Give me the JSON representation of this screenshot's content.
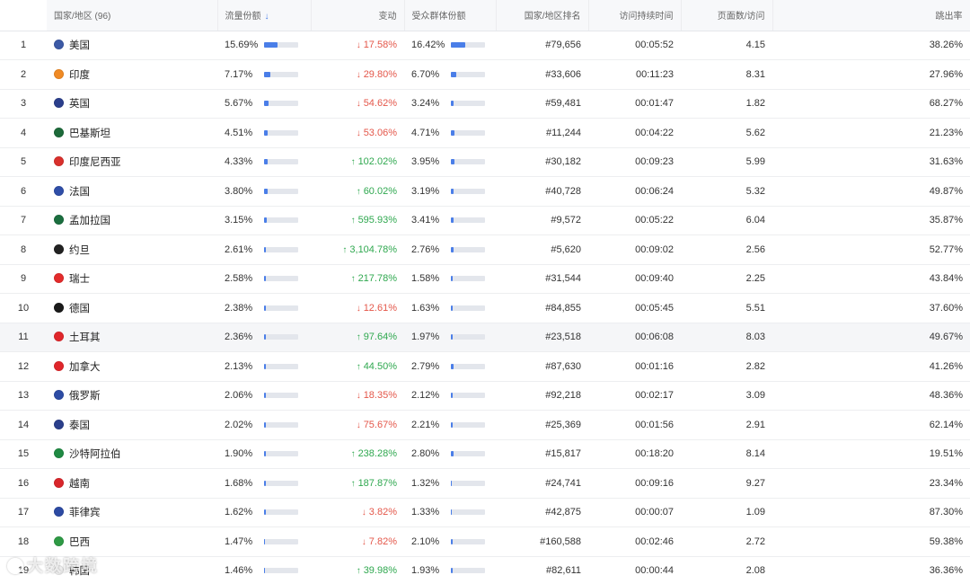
{
  "header": {
    "country": "国家/地区 (96)",
    "traffic_share": "流量份额",
    "change": "变动",
    "audience_share": "受众群体份额",
    "rank": "国家/地区排名",
    "duration": "访问持续时间",
    "pages": "页面数/访问",
    "bounce": "跳出率"
  },
  "rows": [
    {
      "n": "1",
      "name": "美国",
      "share": "15.69%",
      "share_v": 0.1569,
      "dir": "down",
      "chg": "17.58%",
      "aud": "16.42%",
      "aud_v": 0.1642,
      "rank": "#79,656",
      "dur": "00:05:52",
      "pages": "4.15",
      "bounce": "38.26%",
      "flag": "#3c5aa6"
    },
    {
      "n": "2",
      "name": "印度",
      "share": "7.17%",
      "share_v": 0.0717,
      "dir": "down",
      "chg": "29.80%",
      "aud": "6.70%",
      "aud_v": 0.067,
      "rank": "#33,606",
      "dur": "00:11:23",
      "pages": "8.31",
      "bounce": "27.96%",
      "flag": "#f08a24"
    },
    {
      "n": "3",
      "name": "英国",
      "share": "5.67%",
      "share_v": 0.0567,
      "dir": "down",
      "chg": "54.62%",
      "aud": "3.24%",
      "aud_v": 0.0324,
      "rank": "#59,481",
      "dur": "00:01:47",
      "pages": "1.82",
      "bounce": "68.27%",
      "flag": "#2b3f8c"
    },
    {
      "n": "4",
      "name": "巴基斯坦",
      "share": "4.51%",
      "share_v": 0.0451,
      "dir": "down",
      "chg": "53.06%",
      "aud": "4.71%",
      "aud_v": 0.0471,
      "rank": "#11,244",
      "dur": "00:04:22",
      "pages": "5.62",
      "bounce": "21.23%",
      "flag": "#1d6a3a"
    },
    {
      "n": "5",
      "name": "印度尼西亚",
      "share": "4.33%",
      "share_v": 0.0433,
      "dir": "up",
      "chg": "102.02%",
      "aud": "3.95%",
      "aud_v": 0.0395,
      "rank": "#30,182",
      "dur": "00:09:23",
      "pages": "5.99",
      "bounce": "31.63%",
      "flag": "#d9302c"
    },
    {
      "n": "6",
      "name": "法国",
      "share": "3.80%",
      "share_v": 0.038,
      "dir": "up",
      "chg": "60.02%",
      "aud": "3.19%",
      "aud_v": 0.0319,
      "rank": "#40,728",
      "dur": "00:06:24",
      "pages": "5.32",
      "bounce": "49.87%",
      "flag": "#2f4ea8"
    },
    {
      "n": "7",
      "name": "孟加拉国",
      "share": "3.15%",
      "share_v": 0.0315,
      "dir": "up",
      "chg": "595.93%",
      "aud": "3.41%",
      "aud_v": 0.0341,
      "rank": "#9,572",
      "dur": "00:05:22",
      "pages": "6.04",
      "bounce": "35.87%",
      "flag": "#1b6e3f"
    },
    {
      "n": "8",
      "name": "约旦",
      "share": "2.61%",
      "share_v": 0.0261,
      "dir": "up",
      "chg": "3,104.78%",
      "aud": "2.76%",
      "aud_v": 0.0276,
      "rank": "#5,620",
      "dur": "00:09:02",
      "pages": "2.56",
      "bounce": "52.77%",
      "flag": "#222222"
    },
    {
      "n": "9",
      "name": "瑞士",
      "share": "2.58%",
      "share_v": 0.0258,
      "dir": "up",
      "chg": "217.78%",
      "aud": "1.58%",
      "aud_v": 0.0158,
      "rank": "#31,544",
      "dur": "00:09:40",
      "pages": "2.25",
      "bounce": "43.84%",
      "flag": "#e32b2b"
    },
    {
      "n": "10",
      "name": "德国",
      "share": "2.38%",
      "share_v": 0.0238,
      "dir": "down",
      "chg": "12.61%",
      "aud": "1.63%",
      "aud_v": 0.0163,
      "rank": "#84,855",
      "dur": "00:05:45",
      "pages": "5.51",
      "bounce": "37.60%",
      "flag": "#1a1a1a"
    },
    {
      "n": "11",
      "name": "土耳其",
      "share": "2.36%",
      "share_v": 0.0236,
      "dir": "up",
      "chg": "97.64%",
      "aud": "1.97%",
      "aud_v": 0.0197,
      "rank": "#23,518",
      "dur": "00:06:08",
      "pages": "8.03",
      "bounce": "49.67%",
      "flag": "#e0262b"
    },
    {
      "n": "12",
      "name": "加拿大",
      "share": "2.13%",
      "share_v": 0.0213,
      "dir": "up",
      "chg": "44.50%",
      "aud": "2.79%",
      "aud_v": 0.0279,
      "rank": "#87,630",
      "dur": "00:01:16",
      "pages": "2.82",
      "bounce": "41.26%",
      "flag": "#e0262b"
    },
    {
      "n": "13",
      "name": "俄罗斯",
      "share": "2.06%",
      "share_v": 0.0206,
      "dir": "down",
      "chg": "18.35%",
      "aud": "2.12%",
      "aud_v": 0.0212,
      "rank": "#92,218",
      "dur": "00:02:17",
      "pages": "3.09",
      "bounce": "48.36%",
      "flag": "#2d4ca5"
    },
    {
      "n": "14",
      "name": "泰国",
      "share": "2.02%",
      "share_v": 0.0202,
      "dir": "down",
      "chg": "75.67%",
      "aud": "2.21%",
      "aud_v": 0.0221,
      "rank": "#25,369",
      "dur": "00:01:56",
      "pages": "2.91",
      "bounce": "62.14%",
      "flag": "#2b3f8c"
    },
    {
      "n": "15",
      "name": "沙特阿拉伯",
      "share": "1.90%",
      "share_v": 0.019,
      "dir": "up",
      "chg": "238.28%",
      "aud": "2.80%",
      "aud_v": 0.028,
      "rank": "#15,817",
      "dur": "00:18:20",
      "pages": "8.14",
      "bounce": "19.51%",
      "flag": "#1f8a43"
    },
    {
      "n": "16",
      "name": "越南",
      "share": "1.68%",
      "share_v": 0.0168,
      "dir": "up",
      "chg": "187.87%",
      "aud": "1.32%",
      "aud_v": 0.0132,
      "rank": "#24,741",
      "dur": "00:09:16",
      "pages": "9.27",
      "bounce": "23.34%",
      "flag": "#d9262b"
    },
    {
      "n": "17",
      "name": "菲律宾",
      "share": "1.62%",
      "share_v": 0.0162,
      "dir": "down",
      "chg": "3.82%",
      "aud": "1.33%",
      "aud_v": 0.0133,
      "rank": "#42,875",
      "dur": "00:00:07",
      "pages": "1.09",
      "bounce": "87.30%",
      "flag": "#2c4aa3"
    },
    {
      "n": "18",
      "name": "巴西",
      "share": "1.47%",
      "share_v": 0.0147,
      "dir": "down",
      "chg": "7.82%",
      "aud": "2.10%",
      "aud_v": 0.021,
      "rank": "#160,588",
      "dur": "00:02:46",
      "pages": "2.72",
      "bounce": "59.38%",
      "flag": "#2e9a45"
    },
    {
      "n": "19",
      "name": "韩国",
      "share": "1.46%",
      "share_v": 0.0146,
      "dir": "up",
      "chg": "39.98%",
      "aud": "1.93%",
      "aud_v": 0.0193,
      "rank": "#82,611",
      "dur": "00:00:44",
      "pages": "2.08",
      "bounce": "36.36%",
      "flag": "#eeeeee"
    }
  ],
  "highlight_row": 11,
  "watermark": "大数跨境",
  "colors": {
    "up": "#2fa84f",
    "down": "#e4574a",
    "bar": "#4a7ee8",
    "track": "#e3e6ec"
  }
}
